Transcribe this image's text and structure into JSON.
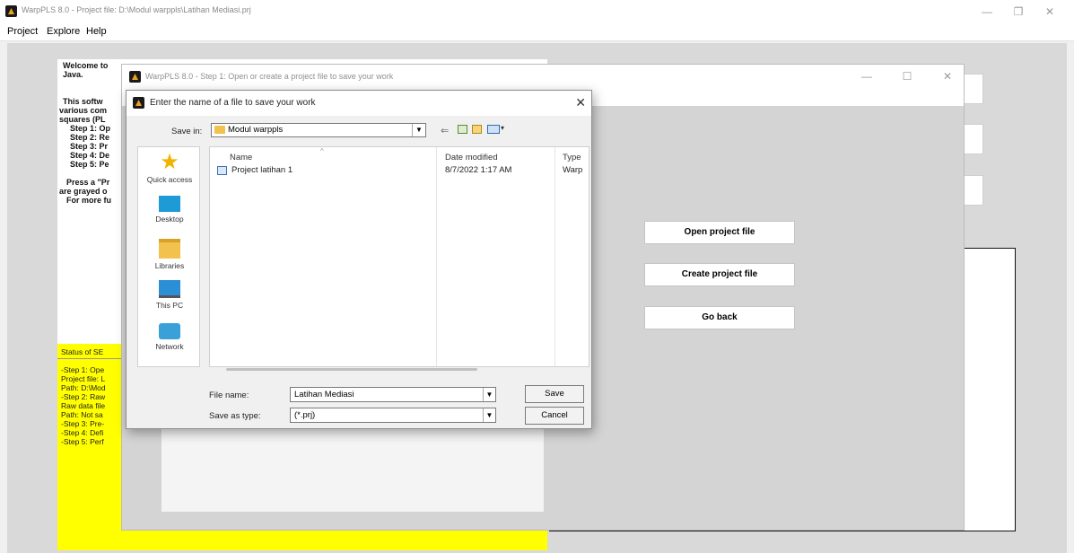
{
  "app": {
    "title": "WarpPLS 8.0 - Project file: D:\\Modul warppls\\Latihan Mediasi.prj",
    "menu": [
      "Project",
      "Explore",
      "Help"
    ]
  },
  "welcome": {
    "lines": [
      "Welcome to",
      "Java.",
      "",
      "This softw",
      "various com",
      "squares (PL",
      "Step 1: Op",
      "Step 2: Re",
      "Step 3: Pr",
      "Step 4: De",
      "Step 5: Pe",
      "",
      "Press a \"Pr",
      "are grayed o",
      "For more fu"
    ],
    "status_title": "Status of SE",
    "status_lines": [
      "-Step 1: Ope",
      " Project file: L",
      " Path: D:\\Mod",
      "-Step 2: Raw",
      " Raw data file",
      " Path: Not sa",
      "-Step 3: Pre-",
      "-Step 4: Defi",
      "-Step 5: Perf"
    ]
  },
  "step1": {
    "title": "WarpPLS 8.0 - Step 1: Open or create a project file to save your work",
    "buttons": {
      "open": "Open project file",
      "create": "Create project file",
      "back": "Go back"
    }
  },
  "dialog": {
    "title": "Enter the name of a file to save your work",
    "save_in_label": "Save in:",
    "save_in_value": "Modul warppls",
    "places": [
      "Quick access",
      "Desktop",
      "Libraries",
      "This PC",
      "Network"
    ],
    "columns": {
      "name": "Name",
      "date": "Date modified",
      "type": "Type"
    },
    "files": [
      {
        "name": "Project latihan 1",
        "date": "8/7/2022 1:17 AM",
        "type": "Warp"
      }
    ],
    "file_name_label": "File name:",
    "file_name_value": "Latihan Mediasi",
    "save_type_label": "Save as type:",
    "save_type_value": "(*.prj)",
    "save_button": "Save",
    "cancel_button": "Cancel"
  }
}
